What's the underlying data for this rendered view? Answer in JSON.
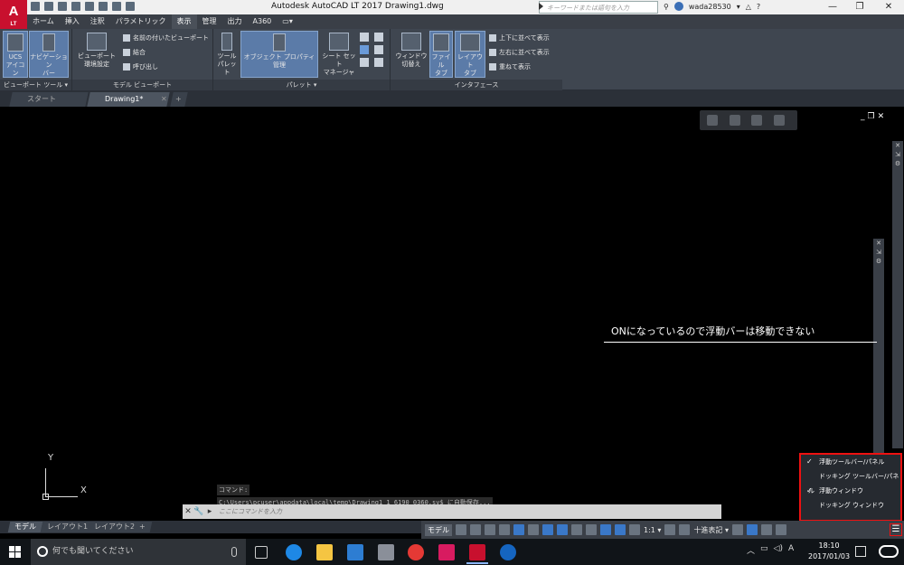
{
  "titlebar": {
    "logo": "A",
    "logo_sub": "LT",
    "title": "Autodesk AutoCAD LT 2017   Drawing1.dwg",
    "search_placeholder": "キーワードまたは語句を入力",
    "username": "wada28530"
  },
  "menu_tabs": [
    "ホーム",
    "挿入",
    "注釈",
    "パラメトリック",
    "表示",
    "管理",
    "出力",
    "A360",
    "▭▾"
  ],
  "ribbon": {
    "panels": {
      "viewport_tools": "ビューポート ツール ▾",
      "model_viewports": "モデル ビューポート",
      "palettes": "パレット ▾",
      "interface": "インタフェース"
    },
    "buttons": {
      "ucs_icon": "UCS\nアイコン",
      "navigation_bar": "ナビゲーション\nバー",
      "viewport_config": "ビューポート\n環境設定",
      "tool_palettes": "ツール\nパレット",
      "properties": "オブジェクト プロパティ管理",
      "sheet_set_manager": "シート セット\nマネージャ",
      "switch_windows": "ウィンドウ\n切替え",
      "file_tabs": "ファイル\nタブ",
      "layout_tabs": "レイアウト\nタブ"
    },
    "small_items": {
      "named_viewports": "名前の付いたビューポート",
      "join": "結合",
      "restore": "呼び出し",
      "tile_horizontal": "上下に並べて表示",
      "tile_vertical": "左右に並べて表示",
      "cascade": "重ねて表示"
    }
  },
  "doc_tabs": [
    {
      "label": "スタート",
      "active": false
    },
    {
      "label": "Drawing1*",
      "active": true
    },
    {
      "label": "+",
      "active": false
    }
  ],
  "annotation": {
    "text": "ONになっているので浮動バーは移動できない"
  },
  "ucs": {
    "x": "X",
    "y": "Y"
  },
  "command": {
    "history": [
      "コマンド:",
      "C:\\Users\\pcuser\\appdata\\local\\temp\\Drawing1_1_6190_0360.sv$ に自動保存..."
    ],
    "placeholder": "ここにコマンドを入力"
  },
  "lock_menu": [
    {
      "label": "浮動ツールバー/パネル",
      "checked": true
    },
    {
      "label": "ドッキング ツールバー/パネル",
      "checked": false
    },
    {
      "label": "浮動ウィンドウ",
      "checked": true
    },
    {
      "label": "ドッキング ウィンドウ",
      "checked": false
    }
  ],
  "layout_tabs": [
    {
      "label": "モデル",
      "active": true
    },
    {
      "label": "レイアウト1",
      "active": false
    },
    {
      "label": "レイアウト2",
      "active": false
    },
    {
      "label": "+",
      "active": false
    }
  ],
  "statusbar": {
    "model": "モデル",
    "scale": "1:1 ▾",
    "units": "十進表記 ▾"
  },
  "taskbar": {
    "search_placeholder": "何でも聞いてください",
    "time": "18:10",
    "date": "2017/01/03",
    "ime": "A"
  }
}
